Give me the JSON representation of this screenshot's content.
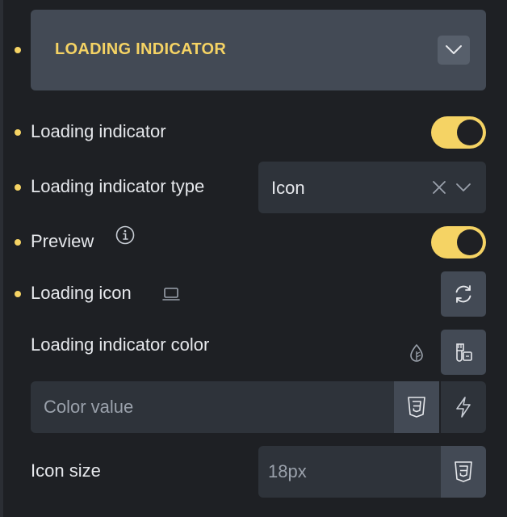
{
  "section": {
    "title": "LOADING INDICATOR",
    "collapse_icon": "chevron-down-icon"
  },
  "fields": {
    "loading_indicator": {
      "label": "Loading indicator",
      "toggle_on": true
    },
    "loading_indicator_type": {
      "label": "Loading indicator type",
      "value": "Icon"
    },
    "preview": {
      "label": "Preview",
      "toggle_on": true,
      "info_icon": "info-icon"
    },
    "loading_icon": {
      "label": "Loading icon",
      "device_icon": "laptop-icon",
      "button_icon": "refresh-icon"
    },
    "loading_indicator_color": {
      "label": "Loading indicator color",
      "placeholder": "Color value",
      "icons": [
        "drop-icon",
        "palette-icon",
        "css3-icon",
        "bolt-icon"
      ]
    },
    "icon_size": {
      "label": "Icon size",
      "placeholder": "18px",
      "icon": "css3-icon"
    }
  },
  "colors": {
    "accent": "#f5d364",
    "background": "#1e2024",
    "panel": "#2e333a",
    "header": "#434a55"
  }
}
